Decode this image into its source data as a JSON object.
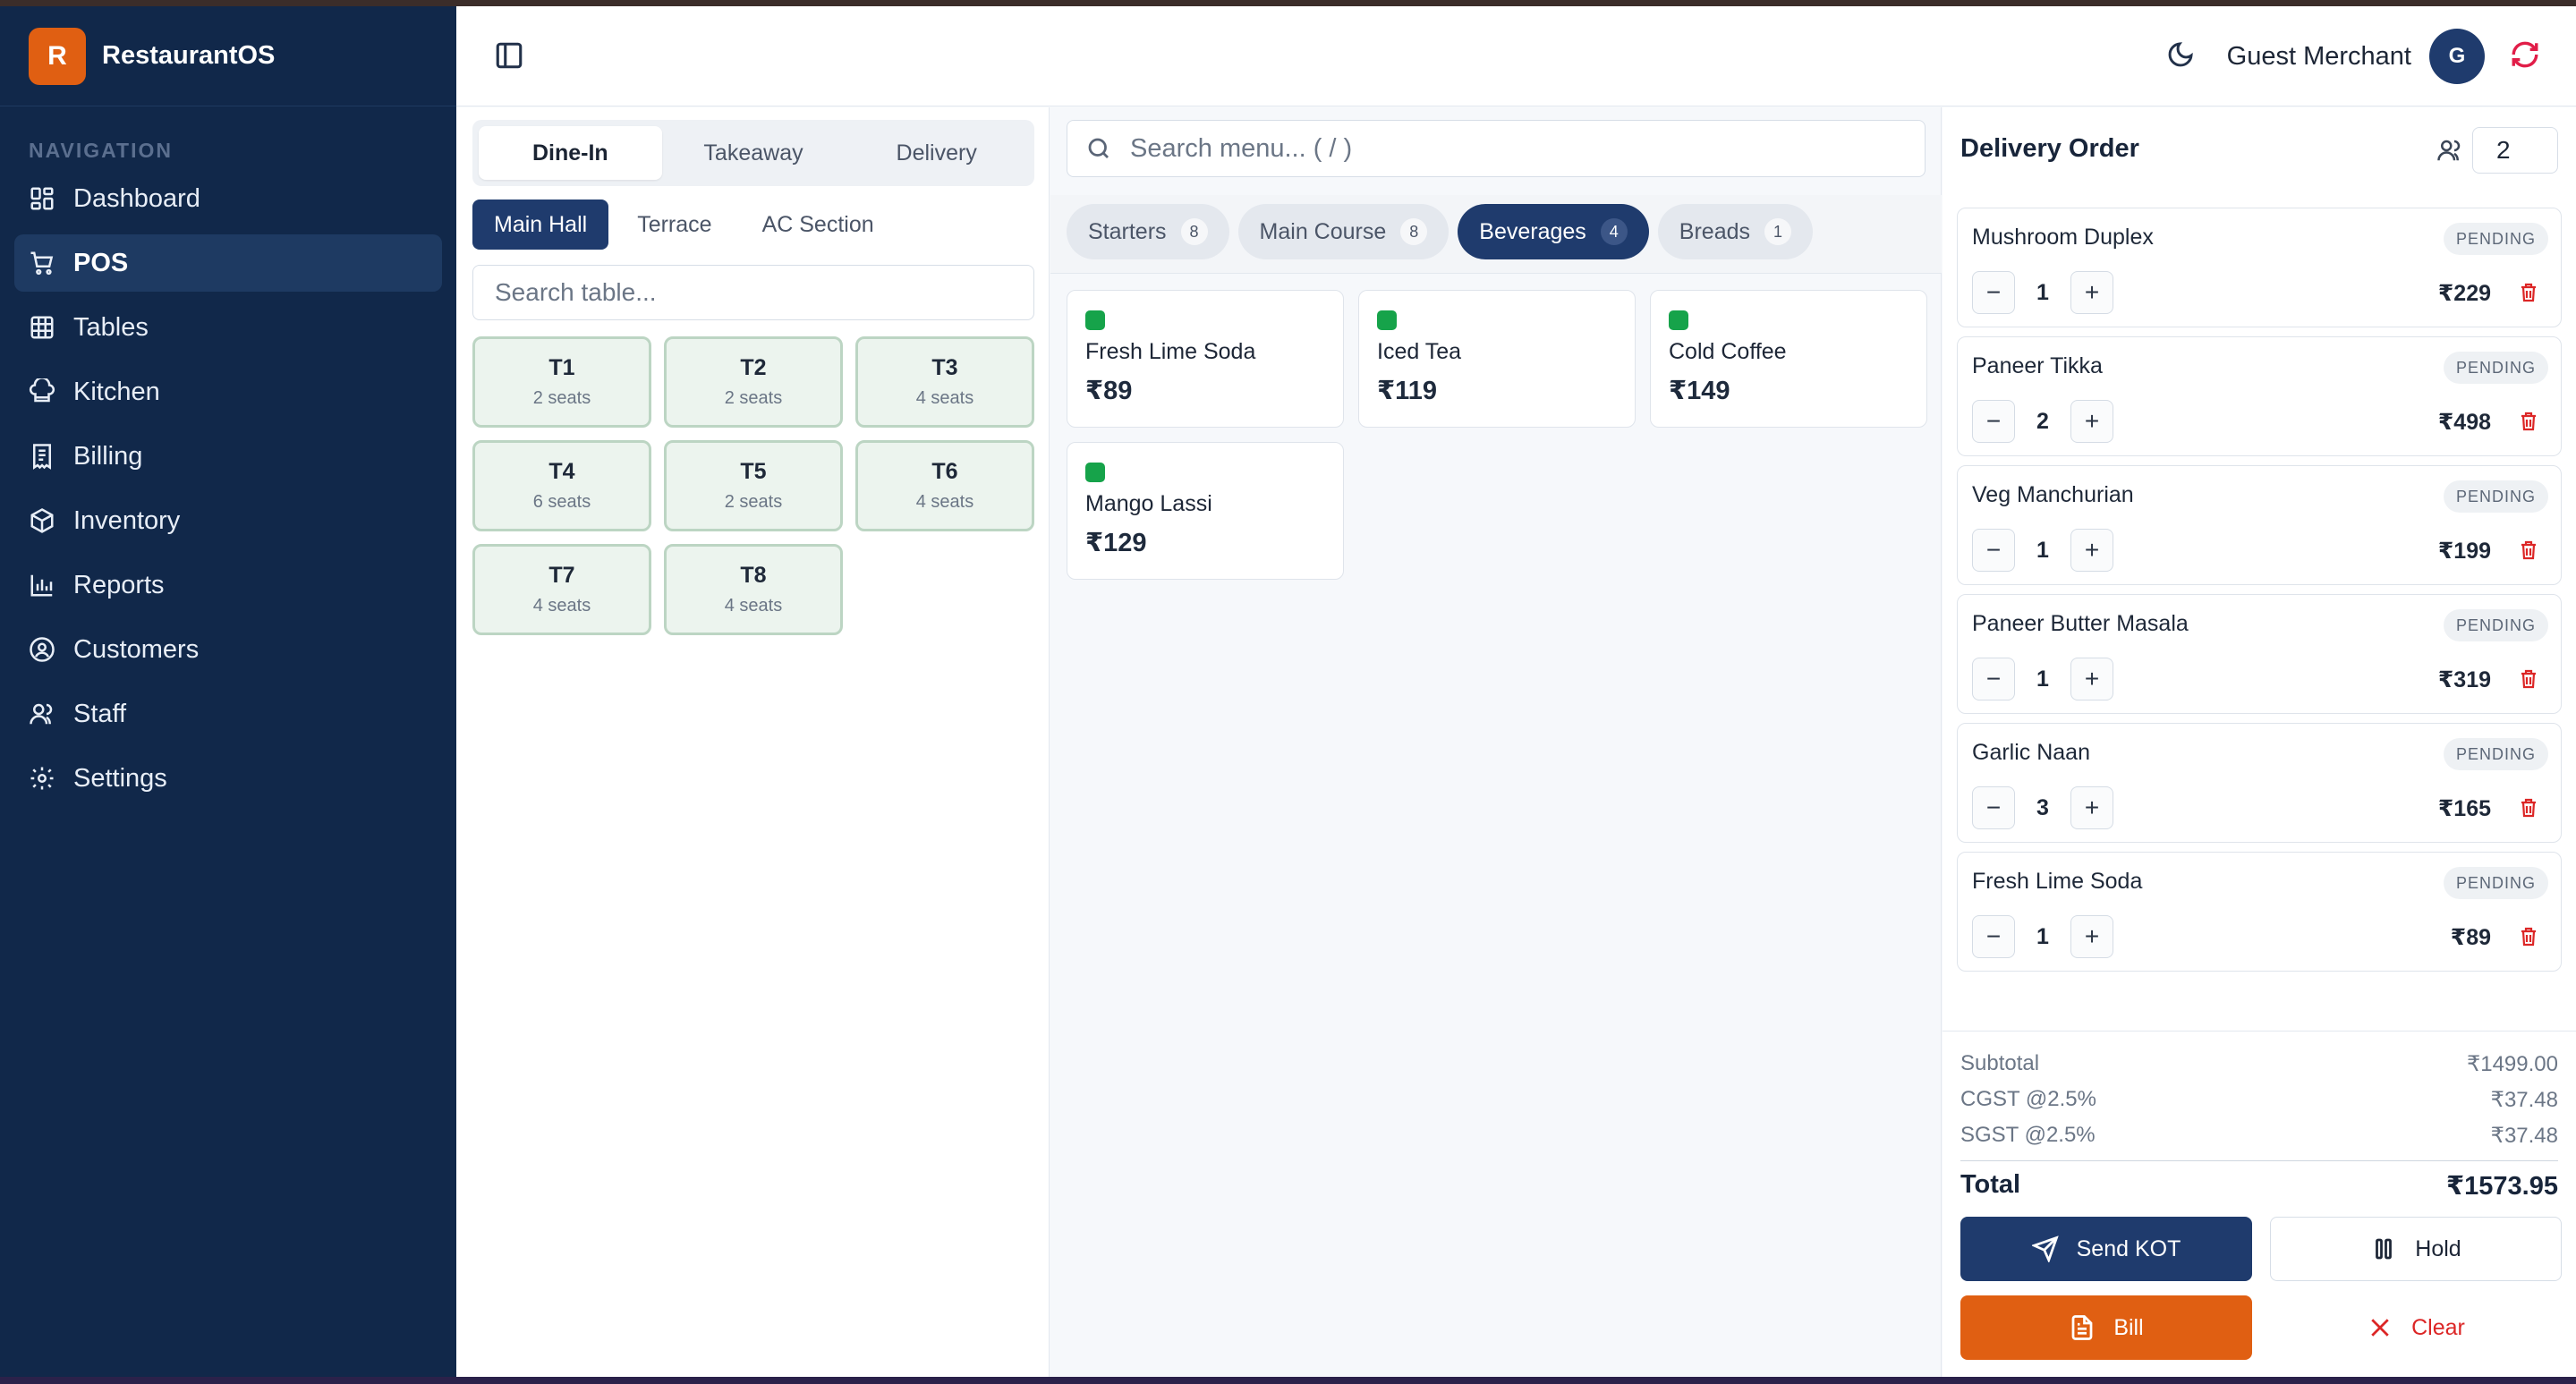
{
  "app": {
    "name": "RestaurantOS",
    "logo_letter": "R"
  },
  "sidebar": {
    "section_title": "NAVIGATION",
    "items": [
      {
        "label": "Dashboard",
        "icon": "dashboard-icon"
      },
      {
        "label": "POS",
        "icon": "cart-icon",
        "active": true
      },
      {
        "label": "Tables",
        "icon": "table-icon"
      },
      {
        "label": "Kitchen",
        "icon": "chef-hat-icon"
      },
      {
        "label": "Billing",
        "icon": "receipt-icon"
      },
      {
        "label": "Inventory",
        "icon": "package-icon"
      },
      {
        "label": "Reports",
        "icon": "bar-chart-icon"
      },
      {
        "label": "Customers",
        "icon": "user-circle-icon"
      },
      {
        "label": "Staff",
        "icon": "users-icon"
      },
      {
        "label": "Settings",
        "icon": "gear-icon"
      }
    ]
  },
  "header": {
    "merchant": "Guest Merchant",
    "avatar_letter": "G"
  },
  "tables_panel": {
    "order_types": [
      "Dine-In",
      "Takeaway",
      "Delivery"
    ],
    "active_order_type": "Dine-In",
    "areas": [
      "Main Hall",
      "Terrace",
      "AC Section"
    ],
    "active_area": "Main Hall",
    "search_placeholder": "Search table...",
    "tables": [
      {
        "name": "T1",
        "seats": "2 seats"
      },
      {
        "name": "T2",
        "seats": "2 seats"
      },
      {
        "name": "T3",
        "seats": "4 seats"
      },
      {
        "name": "T4",
        "seats": "6 seats"
      },
      {
        "name": "T5",
        "seats": "2 seats"
      },
      {
        "name": "T6",
        "seats": "4 seats"
      },
      {
        "name": "T7",
        "seats": "4 seats"
      },
      {
        "name": "T8",
        "seats": "4 seats"
      }
    ]
  },
  "menu_panel": {
    "search_placeholder": "Search menu... ( / )",
    "categories": [
      {
        "label": "Starters",
        "count": "8"
      },
      {
        "label": "Main Course",
        "count": "8"
      },
      {
        "label": "Beverages",
        "count": "4",
        "active": true
      },
      {
        "label": "Breads",
        "count": "1"
      }
    ],
    "items": [
      {
        "name": "Fresh Lime Soda",
        "price": "₹89"
      },
      {
        "name": "Iced Tea",
        "price": "₹119"
      },
      {
        "name": "Cold Coffee",
        "price": "₹149"
      },
      {
        "name": "Mango Lassi",
        "price": "₹129"
      }
    ]
  },
  "order_panel": {
    "title": "Delivery Order",
    "guests": "2",
    "items": [
      {
        "name": "Mushroom Duplex",
        "status": "PENDING",
        "qty": "1",
        "price": "₹229"
      },
      {
        "name": "Paneer Tikka",
        "status": "PENDING",
        "qty": "2",
        "price": "₹498"
      },
      {
        "name": "Veg Manchurian",
        "status": "PENDING",
        "qty": "1",
        "price": "₹199"
      },
      {
        "name": "Paneer Butter Masala",
        "status": "PENDING",
        "qty": "1",
        "price": "₹319"
      },
      {
        "name": "Garlic Naan",
        "status": "PENDING",
        "qty": "3",
        "price": "₹165"
      },
      {
        "name": "Fresh Lime Soda",
        "status": "PENDING",
        "qty": "1",
        "price": "₹89"
      }
    ],
    "summary": {
      "subtotal_label": "Subtotal",
      "subtotal": "₹1499.00",
      "cgst_label": "CGST @2.5%",
      "cgst": "₹37.48",
      "sgst_label": "SGST @2.5%",
      "sgst": "₹37.48",
      "total_label": "Total",
      "total": "₹1573.95"
    },
    "actions": {
      "send_kot": "Send KOT",
      "hold": "Hold",
      "bill": "Bill",
      "clear": "Clear"
    }
  },
  "colors": {
    "sidebar": "#11284a",
    "accent": "#1f3b6d",
    "brand": "#e05f12",
    "veg": "#16a34a",
    "danger": "#dc2626"
  }
}
